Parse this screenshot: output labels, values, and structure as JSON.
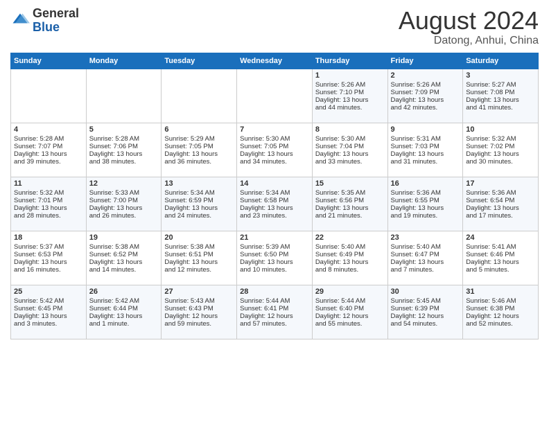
{
  "header": {
    "logo_general": "General",
    "logo_blue": "Blue",
    "month_title": "August 2024",
    "location": "Datong, Anhui, China"
  },
  "days_of_week": [
    "Sunday",
    "Monday",
    "Tuesday",
    "Wednesday",
    "Thursday",
    "Friday",
    "Saturday"
  ],
  "weeks": [
    [
      {
        "day": "",
        "content": ""
      },
      {
        "day": "",
        "content": ""
      },
      {
        "day": "",
        "content": ""
      },
      {
        "day": "",
        "content": ""
      },
      {
        "day": "1",
        "content": "Sunrise: 5:26 AM\nSunset: 7:10 PM\nDaylight: 13 hours\nand 44 minutes."
      },
      {
        "day": "2",
        "content": "Sunrise: 5:26 AM\nSunset: 7:09 PM\nDaylight: 13 hours\nand 42 minutes."
      },
      {
        "day": "3",
        "content": "Sunrise: 5:27 AM\nSunset: 7:08 PM\nDaylight: 13 hours\nand 41 minutes."
      }
    ],
    [
      {
        "day": "4",
        "content": "Sunrise: 5:28 AM\nSunset: 7:07 PM\nDaylight: 13 hours\nand 39 minutes."
      },
      {
        "day": "5",
        "content": "Sunrise: 5:28 AM\nSunset: 7:06 PM\nDaylight: 13 hours\nand 38 minutes."
      },
      {
        "day": "6",
        "content": "Sunrise: 5:29 AM\nSunset: 7:05 PM\nDaylight: 13 hours\nand 36 minutes."
      },
      {
        "day": "7",
        "content": "Sunrise: 5:30 AM\nSunset: 7:05 PM\nDaylight: 13 hours\nand 34 minutes."
      },
      {
        "day": "8",
        "content": "Sunrise: 5:30 AM\nSunset: 7:04 PM\nDaylight: 13 hours\nand 33 minutes."
      },
      {
        "day": "9",
        "content": "Sunrise: 5:31 AM\nSunset: 7:03 PM\nDaylight: 13 hours\nand 31 minutes."
      },
      {
        "day": "10",
        "content": "Sunrise: 5:32 AM\nSunset: 7:02 PM\nDaylight: 13 hours\nand 30 minutes."
      }
    ],
    [
      {
        "day": "11",
        "content": "Sunrise: 5:32 AM\nSunset: 7:01 PM\nDaylight: 13 hours\nand 28 minutes."
      },
      {
        "day": "12",
        "content": "Sunrise: 5:33 AM\nSunset: 7:00 PM\nDaylight: 13 hours\nand 26 minutes."
      },
      {
        "day": "13",
        "content": "Sunrise: 5:34 AM\nSunset: 6:59 PM\nDaylight: 13 hours\nand 24 minutes."
      },
      {
        "day": "14",
        "content": "Sunrise: 5:34 AM\nSunset: 6:58 PM\nDaylight: 13 hours\nand 23 minutes."
      },
      {
        "day": "15",
        "content": "Sunrise: 5:35 AM\nSunset: 6:56 PM\nDaylight: 13 hours\nand 21 minutes."
      },
      {
        "day": "16",
        "content": "Sunrise: 5:36 AM\nSunset: 6:55 PM\nDaylight: 13 hours\nand 19 minutes."
      },
      {
        "day": "17",
        "content": "Sunrise: 5:36 AM\nSunset: 6:54 PM\nDaylight: 13 hours\nand 17 minutes."
      }
    ],
    [
      {
        "day": "18",
        "content": "Sunrise: 5:37 AM\nSunset: 6:53 PM\nDaylight: 13 hours\nand 16 minutes."
      },
      {
        "day": "19",
        "content": "Sunrise: 5:38 AM\nSunset: 6:52 PM\nDaylight: 13 hours\nand 14 minutes."
      },
      {
        "day": "20",
        "content": "Sunrise: 5:38 AM\nSunset: 6:51 PM\nDaylight: 13 hours\nand 12 minutes."
      },
      {
        "day": "21",
        "content": "Sunrise: 5:39 AM\nSunset: 6:50 PM\nDaylight: 13 hours\nand 10 minutes."
      },
      {
        "day": "22",
        "content": "Sunrise: 5:40 AM\nSunset: 6:49 PM\nDaylight: 13 hours\nand 8 minutes."
      },
      {
        "day": "23",
        "content": "Sunrise: 5:40 AM\nSunset: 6:47 PM\nDaylight: 13 hours\nand 7 minutes."
      },
      {
        "day": "24",
        "content": "Sunrise: 5:41 AM\nSunset: 6:46 PM\nDaylight: 13 hours\nand 5 minutes."
      }
    ],
    [
      {
        "day": "25",
        "content": "Sunrise: 5:42 AM\nSunset: 6:45 PM\nDaylight: 13 hours\nand 3 minutes."
      },
      {
        "day": "26",
        "content": "Sunrise: 5:42 AM\nSunset: 6:44 PM\nDaylight: 13 hours\nand 1 minute."
      },
      {
        "day": "27",
        "content": "Sunrise: 5:43 AM\nSunset: 6:43 PM\nDaylight: 12 hours\nand 59 minutes."
      },
      {
        "day": "28",
        "content": "Sunrise: 5:44 AM\nSunset: 6:41 PM\nDaylight: 12 hours\nand 57 minutes."
      },
      {
        "day": "29",
        "content": "Sunrise: 5:44 AM\nSunset: 6:40 PM\nDaylight: 12 hours\nand 55 minutes."
      },
      {
        "day": "30",
        "content": "Sunrise: 5:45 AM\nSunset: 6:39 PM\nDaylight: 12 hours\nand 54 minutes."
      },
      {
        "day": "31",
        "content": "Sunrise: 5:46 AM\nSunset: 6:38 PM\nDaylight: 12 hours\nand 52 minutes."
      }
    ]
  ]
}
